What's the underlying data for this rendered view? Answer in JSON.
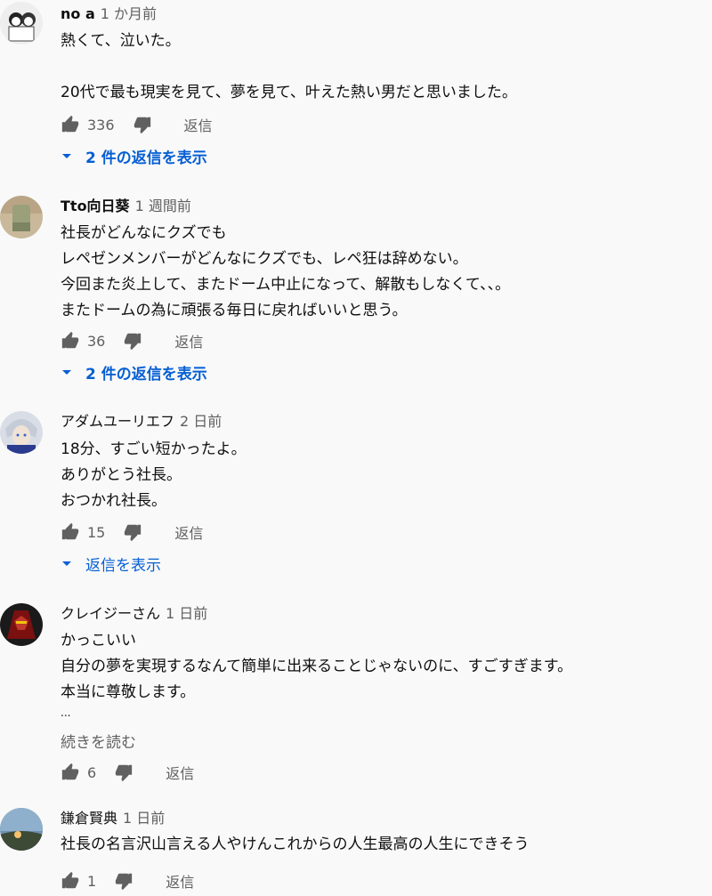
{
  "comments": [
    {
      "author": "no a",
      "time": "1 か月前",
      "lines": [
        "熱くて、泣いた。",
        "",
        "20代で最も現実を見て、夢を見て、叶えた熱い男だと思いました。"
      ],
      "likes": "336",
      "reply": "返信",
      "replies_label": "2 件の返信を表示"
    },
    {
      "author": "Tto向日葵",
      "time": "1 週間前",
      "lines": [
        "社長がどんなにクズでも",
        "レペゼンメンバーがどんなにクズでも、レペ狂は辞めない。",
        "今回また炎上して、またドーム中止になって、解散もしなくて、、。",
        "またドームの為に頑張る毎日に戻ればいいと思う。"
      ],
      "likes": "36",
      "reply": "返信",
      "replies_label": "2 件の返信を表示"
    },
    {
      "author": "アダムユーリエフ",
      "time": "2 日前",
      "lines": [
        "18分、すごい短かったよ。",
        "ありがとう社長。",
        "おつかれ社長。"
      ],
      "likes": "15",
      "reply": "返信",
      "replies_label": "返信を表示"
    },
    {
      "author": "クレイジーさん",
      "time": "1 日前",
      "lines": [
        "かっこいい",
        "自分の夢を実現するなんて簡単に出来ることじゃないのに、すごすぎます。",
        "本当に尊敬します。"
      ],
      "ellipsis": "...",
      "read_more": "続きを読む",
      "likes": "6",
      "reply": "返信"
    },
    {
      "author": "鎌倉賢典",
      "time": "1 日前",
      "lines": [
        "社長の名言沢山言える人やけんこれからの人生最高の人生にできそう"
      ],
      "likes": "1",
      "reply": "返信"
    }
  ],
  "icons": {
    "like": "thumb-up-icon",
    "dislike": "thumb-down-icon",
    "expand": "caret-down-icon"
  },
  "colors": {
    "background": "#f9f9f9",
    "text": "#0f0f0f",
    "secondary": "#606060",
    "link": "#065fd4"
  }
}
